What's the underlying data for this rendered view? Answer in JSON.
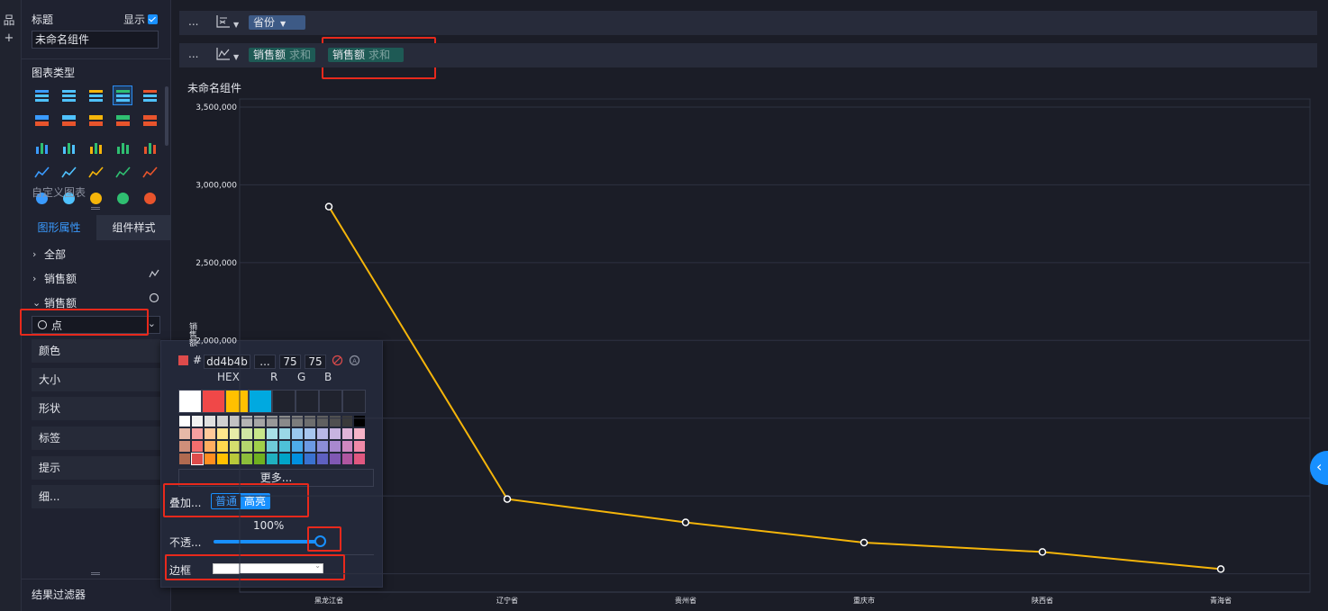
{
  "panel": {
    "title_label": "标题",
    "show_label": "显示",
    "title_value": "未命名组件",
    "chart_type_label": "图表类型",
    "custom_chart_label": "自定义图表",
    "tabs": [
      "图形属性",
      "组件样式"
    ],
    "tree": [
      {
        "label": "全部",
        "expanded": false
      },
      {
        "label": "销售额",
        "expanded": false,
        "icon": "line-chart-icon"
      },
      {
        "label": "销售额",
        "expanded": true,
        "icon": "circle-icon"
      }
    ],
    "marker_select": "点",
    "props": [
      "颜色",
      "大小",
      "形状",
      "标签",
      "提示",
      "细..."
    ],
    "filter_label": "结果过滤器"
  },
  "picker": {
    "hex_value": "dd4b4b",
    "r_value": "...",
    "g_value": "75",
    "b_value": "75",
    "hex_label": "HEX",
    "r_label": "R",
    "g_label": "G",
    "b_label": "B",
    "more_label": "更多...",
    "overlay_label": "叠加...",
    "overlay_normal": "普通",
    "overlay_highlight": "高亮",
    "opacity_label": "不透...",
    "opacity_value": "100%",
    "border_label": "边框",
    "selected_color": "#dd4b4b",
    "recent": [
      "#ffffff",
      "#f04848",
      "#ffc000",
      "#00a9e0",
      "#20232e",
      "#20232e",
      "#20232e",
      "#20232e"
    ]
  },
  "fields": {
    "dimension": "省份",
    "measures": [
      {
        "name": "销售额",
        "agg": "求和"
      },
      {
        "name": "销售额",
        "agg": "求和"
      }
    ]
  },
  "chart_title": "未命名组件",
  "chart_data": {
    "type": "line",
    "categories": [
      "黑龙江省",
      "辽宁省",
      "贵州省",
      "重庆市",
      "陕西省",
      "青海省"
    ],
    "series": [
      {
        "name": "销售额",
        "values": [
          2860000,
          980000,
          830000,
          700000,
          640000,
          530000
        ],
        "color": "#f5b50a"
      }
    ],
    "ylabel": "销售额",
    "y_ticks": [
      "3,500,000",
      "3,000,000",
      "2,500,000",
      "2,000,000"
    ],
    "ylim": [
      0,
      3500000
    ],
    "grid": true
  }
}
